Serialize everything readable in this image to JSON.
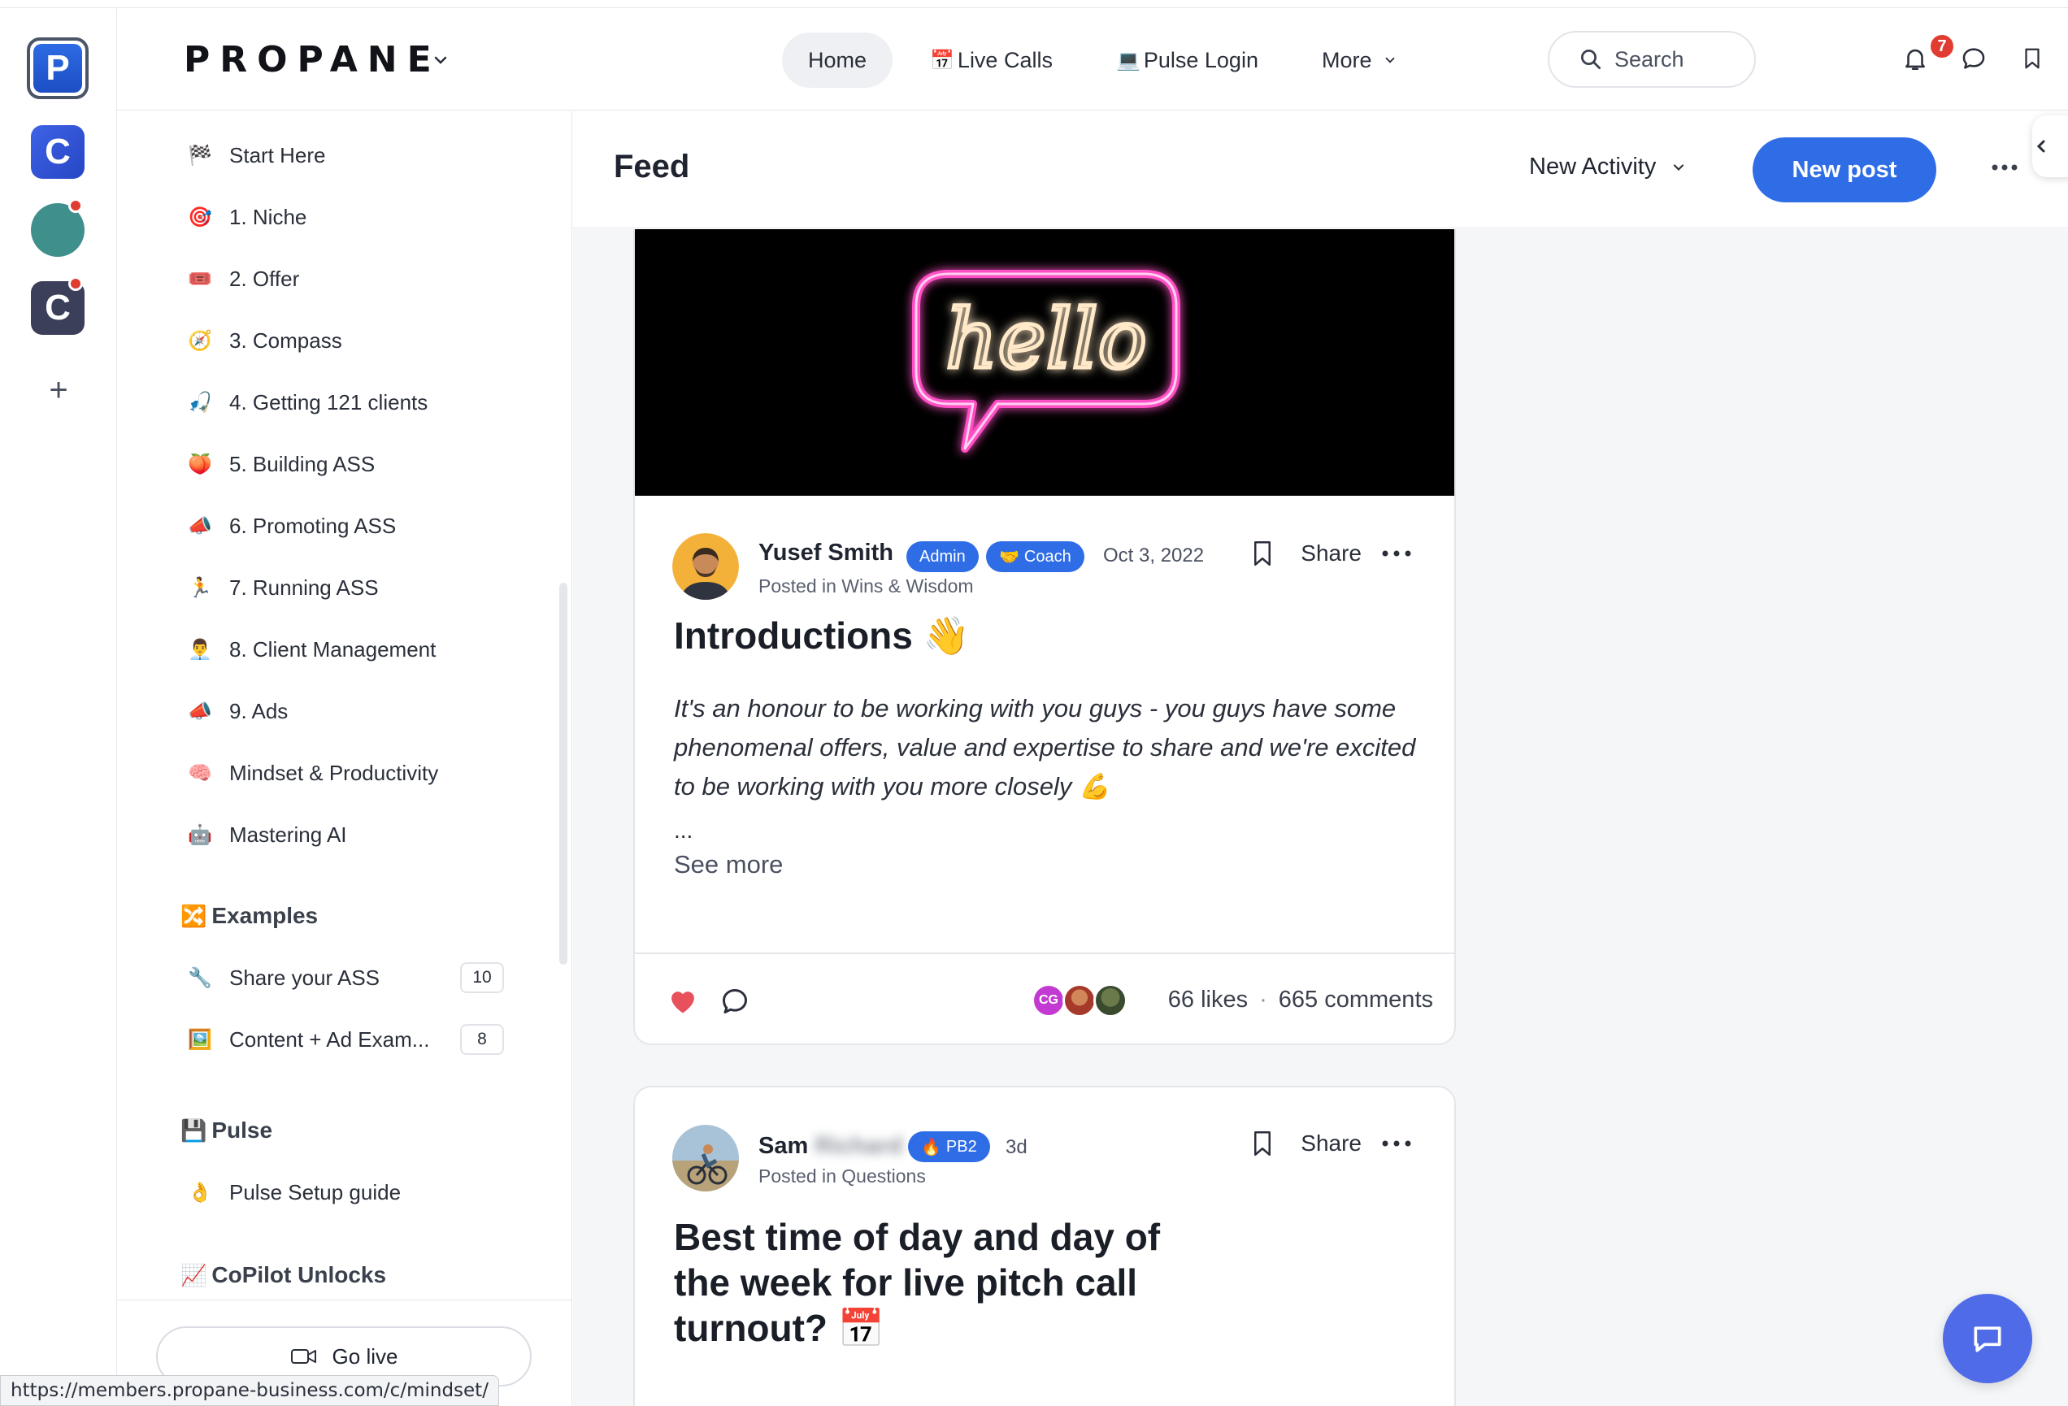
{
  "brand": {
    "name": "PROPANE"
  },
  "nav": {
    "home": "Home",
    "live_calls": "Live Calls",
    "live_calls_emoji": "📅",
    "pulse_login": "Pulse Login",
    "pulse_login_emoji": "💻",
    "more": "More"
  },
  "search": {
    "label": "Search"
  },
  "notifications": {
    "count": "7"
  },
  "rail": {
    "p_letter": "P",
    "c_letter": "C"
  },
  "sidebar": {
    "items": [
      {
        "emoji": "🏁",
        "label": "Start Here"
      },
      {
        "emoji": "🎯",
        "label": "1. Niche"
      },
      {
        "emoji": "🎟️",
        "label": "2. Offer"
      },
      {
        "emoji": "🧭",
        "label": "3. Compass"
      },
      {
        "emoji": "🎣",
        "label": "4. Getting 121 clients"
      },
      {
        "emoji": "🍑",
        "label": "5. Building ASS"
      },
      {
        "emoji": "📣",
        "label": "6. Promoting ASS"
      },
      {
        "emoji": "🏃",
        "label": "7. Running ASS"
      },
      {
        "emoji": "👨‍💼",
        "label": "8. Client Management"
      },
      {
        "emoji": "📣",
        "label": "9. Ads"
      },
      {
        "emoji": "🧠",
        "label": "Mindset & Productivity"
      },
      {
        "emoji": "🤖",
        "label": "Mastering AI"
      }
    ],
    "examples_heading": "Examples",
    "examples_emoji": "🔀",
    "examples": [
      {
        "emoji": "🔧",
        "label": "Share your ASS",
        "count": "10"
      },
      {
        "emoji": "🖼️",
        "label": "Content + Ad Exam...",
        "count": "8"
      }
    ],
    "pulse_heading": "Pulse",
    "pulse_emoji": "💾",
    "pulse_items": [
      {
        "emoji": "👌",
        "label": "Pulse Setup guide"
      }
    ],
    "copilot_heading": "CoPilot Unlocks",
    "copilot_emoji": "📈",
    "go_live": "Go live"
  },
  "status_url": "https://members.propane-business.com/c/mindset/",
  "feed": {
    "title": "Feed",
    "sort": "New Activity",
    "new_post": "New post"
  },
  "posts": [
    {
      "cover_text": "hello",
      "author": "Yusef Smith",
      "tags": [
        "Admin",
        "Coach"
      ],
      "coach_emoji": "🤝",
      "date": "Oct 3, 2022",
      "posted_in": "Posted in Wins & Wisdom",
      "share": "Share",
      "title": "Introductions 👋",
      "body": "It's an honour to be working with you guys - you guys have some phenomenal offers, value and expertise to share and we're excited to be working with you more closely 💪",
      "ellipsis": "...",
      "see_more": "See more",
      "liker_initials": "CG",
      "likes": "66 likes",
      "comments": "665 comments"
    },
    {
      "author": "Sam",
      "author_blurred": "Richard",
      "tags": [
        "PB2"
      ],
      "tag_emoji": "🔥",
      "date": "3d",
      "posted_in": "Posted in Questions",
      "share": "Share",
      "title": "Best time of day and day of the week for live pitch call turnout? 📅"
    }
  ],
  "colors": {
    "accent": "#2f6de6",
    "notification": "#e03c31",
    "chat_fab": "#4f6be8",
    "heart": "#e8505b"
  }
}
